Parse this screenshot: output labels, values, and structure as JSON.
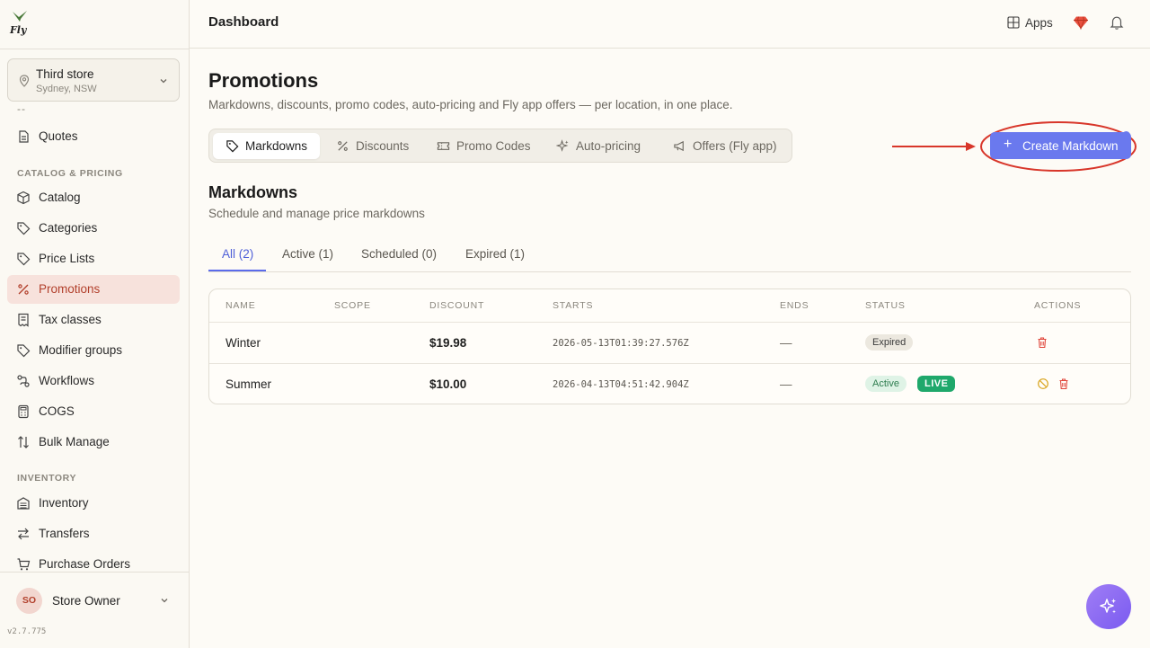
{
  "app": {
    "version": "v2.7.775"
  },
  "store": {
    "name": "Third store",
    "location": "Sydney, NSW"
  },
  "sidebar": {
    "truncated": "--",
    "items_top": [
      {
        "label": "Quotes",
        "icon": "document-icon"
      }
    ],
    "section_catalog": "CATALOG & PRICING",
    "items_catalog": [
      {
        "label": "Catalog",
        "icon": "box-icon"
      },
      {
        "label": "Categories",
        "icon": "tag-icon"
      },
      {
        "label": "Price Lists",
        "icon": "tag-icon"
      },
      {
        "label": "Promotions",
        "icon": "percent-icon",
        "active": true
      },
      {
        "label": "Tax classes",
        "icon": "receipt-icon"
      },
      {
        "label": "Modifier groups",
        "icon": "tag-icon"
      },
      {
        "label": "Workflows",
        "icon": "workflow-icon"
      },
      {
        "label": "COGS",
        "icon": "calculator-icon"
      },
      {
        "label": "Bulk Manage",
        "icon": "sort-icon"
      }
    ],
    "section_inventory": "INVENTORY",
    "items_inventory": [
      {
        "label": "Inventory",
        "icon": "warehouse-icon"
      },
      {
        "label": "Transfers",
        "icon": "transfer-icon"
      },
      {
        "label": "Purchase Orders",
        "icon": "cart-icon"
      }
    ]
  },
  "user": {
    "initials": "SO",
    "name": "Store Owner"
  },
  "topbar": {
    "title": "Dashboard",
    "apps_label": "Apps"
  },
  "page": {
    "title": "Promotions",
    "subtitle": "Markdowns, discounts, promo codes, auto-pricing and Fly app offers — per location, in one place."
  },
  "tabs": [
    {
      "label": "Markdowns",
      "icon": "tag-icon",
      "active": true
    },
    {
      "label": "Discounts",
      "icon": "percent-icon"
    },
    {
      "label": "Promo Codes",
      "icon": "ticket-icon"
    },
    {
      "label": "Auto-pricing",
      "icon": "sparkle-icon"
    },
    {
      "label": "Offers (Fly app)",
      "icon": "megaphone-icon"
    }
  ],
  "cta": {
    "label": "Create Markdown"
  },
  "section": {
    "title": "Markdowns",
    "subtitle": "Schedule and manage price markdowns"
  },
  "filter_tabs": [
    {
      "label": "All (2)",
      "active": true
    },
    {
      "label": "Active (1)"
    },
    {
      "label": "Scheduled (0)"
    },
    {
      "label": "Expired (1)"
    }
  ],
  "table": {
    "headers": [
      "NAME",
      "SCOPE",
      "DISCOUNT",
      "STARTS",
      "ENDS",
      "STATUS",
      "ACTIONS"
    ],
    "rows": [
      {
        "name": "Winter",
        "scope": "",
        "discount": "$19.98",
        "starts": "2026-05-13T01:39:27.576Z",
        "ends": "—",
        "status": "Expired",
        "live": ""
      },
      {
        "name": "Summer",
        "scope": "",
        "discount": "$10.00",
        "starts": "2026-04-13T04:51:42.904Z",
        "ends": "—",
        "status": "Active",
        "live": "LIVE"
      }
    ]
  },
  "colors": {
    "accent": "#6a79ee",
    "active_nav": "#f7e2dc",
    "live": "#1fa86b",
    "danger": "#e0453a"
  }
}
